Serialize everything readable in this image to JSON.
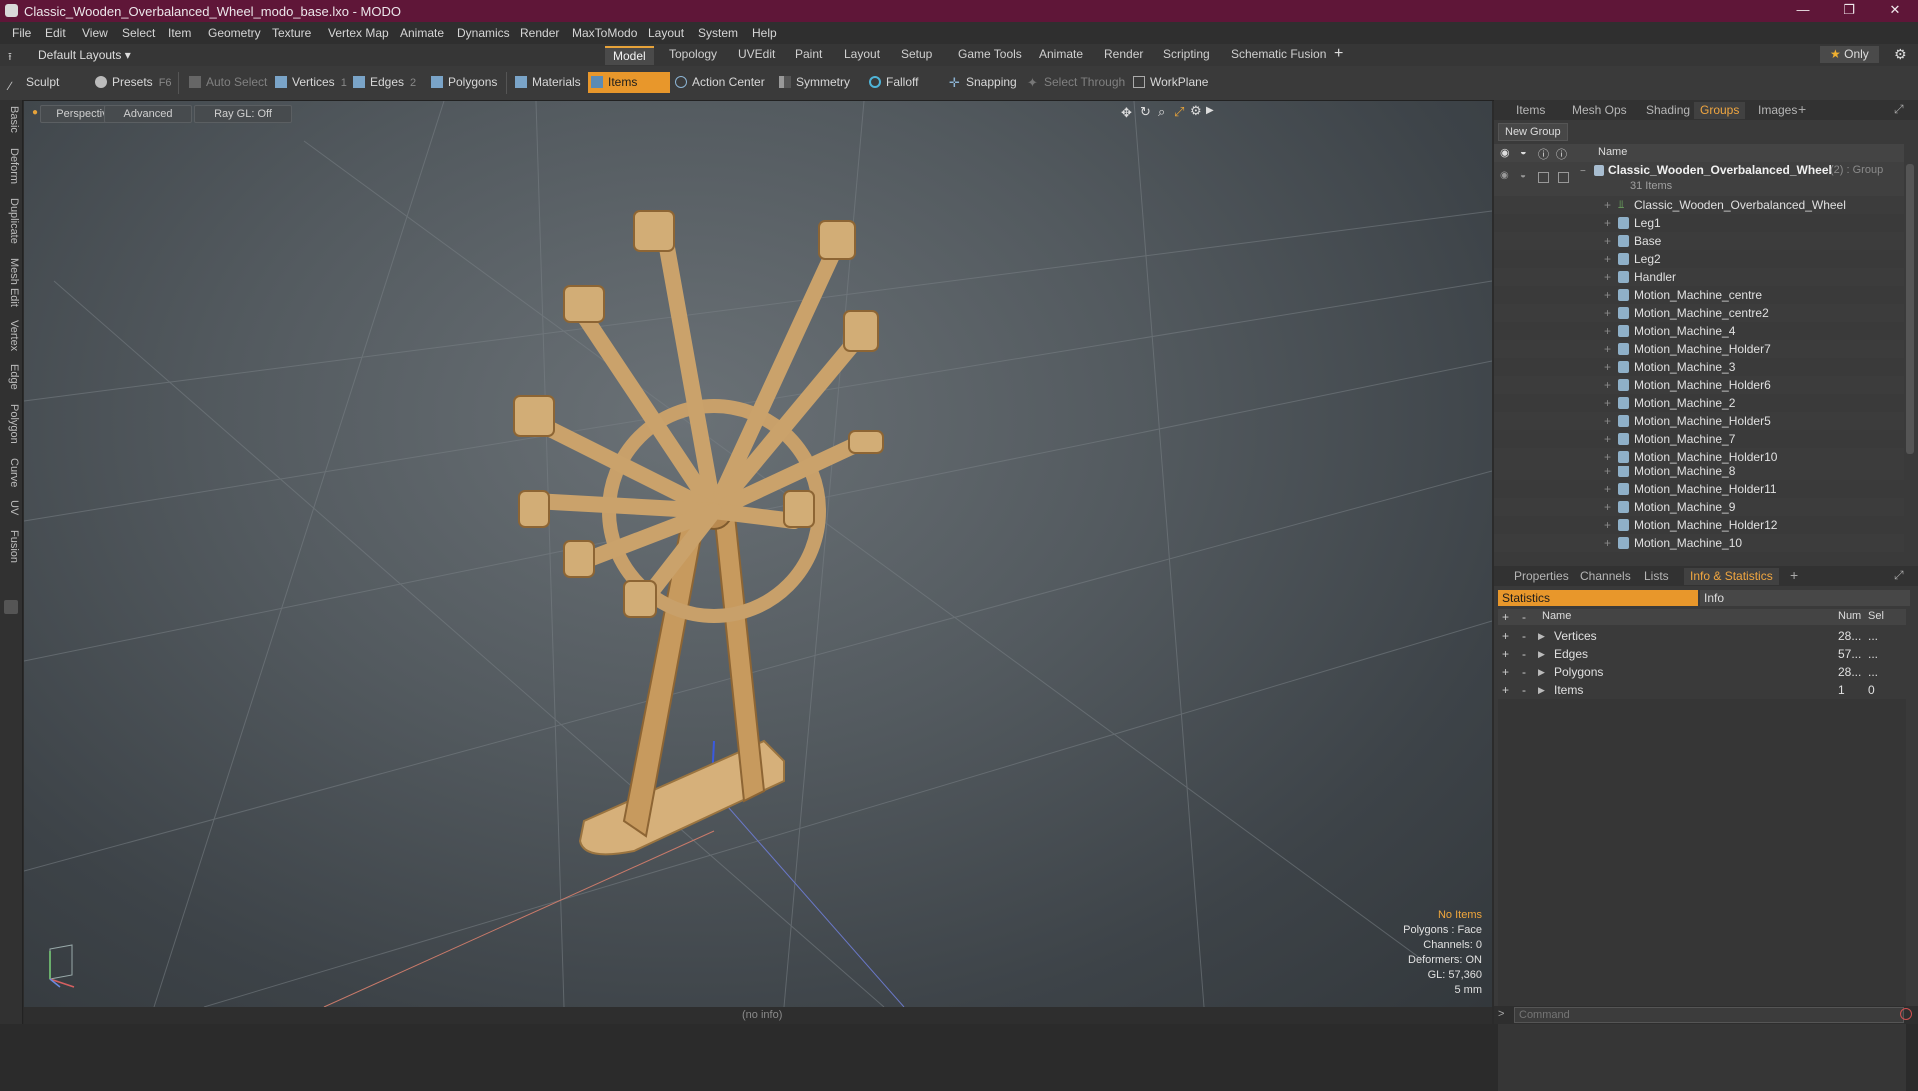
{
  "window": {
    "title": "Classic_Wooden_Overbalanced_Wheel_modo_base.lxo - MODO"
  },
  "menu": [
    "File",
    "Edit",
    "View",
    "Select",
    "Item",
    "Geometry",
    "Texture",
    "Vertex Map",
    "Animate",
    "Dynamics",
    "Render",
    "MaxToModo",
    "Layout",
    "System",
    "Help"
  ],
  "layouts": {
    "selector": "Default Layouts",
    "tabs": [
      "Model",
      "Topology",
      "UVEdit",
      "Paint",
      "Layout",
      "Setup",
      "Game Tools",
      "Animate",
      "Render",
      "Scripting",
      "Schematic Fusion"
    ],
    "active": "Model",
    "only_label": "Only"
  },
  "toolbar": {
    "sculpt": "Sculpt",
    "presets": "Presets",
    "presets_key": "F6",
    "auto_select": "Auto Select",
    "vertices": "Vertices",
    "vertices_num": "1",
    "edges": "Edges",
    "edges_num": "2",
    "polygons": "Polygons",
    "materials": "Materials",
    "items": "Items",
    "action_center": "Action Center",
    "symmetry": "Symmetry",
    "falloff": "Falloff",
    "snapping": "Snapping",
    "select_through": "Select Through",
    "workplane": "WorkPlane"
  },
  "left_tabs": [
    "Basic",
    "Deform",
    "Duplicate",
    "Mesh Edit",
    "Vertex",
    "Edge",
    "Polygon",
    "Curve",
    "UV",
    "Fusion"
  ],
  "viewport": {
    "view_mode": "Perspective",
    "shading": "Advanced",
    "raygl": "Ray GL: Off",
    "stats": {
      "selection": "No Items",
      "polygons": "Polygons : Face",
      "channels": "Channels: 0",
      "deformers": "Deformers: ON",
      "gl": "GL: 57,360",
      "scale": "5 mm"
    },
    "status": "(no info)",
    "colors": {
      "stats_highlight": "#f0a63c",
      "wood": "#c9a06a"
    }
  },
  "outliner": {
    "tabs": [
      "Items",
      "Mesh Ops",
      "Shading",
      "Groups",
      "Images"
    ],
    "active_tab": "Groups",
    "new_group": "New Group",
    "col_name": "Name",
    "group_name": "Classic_Wooden_Overbalanced_Wheel",
    "group_suffix": "(2) : Group",
    "group_count": "31 Items",
    "items": [
      "Classic_Wooden_Overbalanced_Wheel",
      "Leg1",
      "Base",
      "Leg2",
      "Handler",
      "Motion_Machine_centre",
      "Motion_Machine_centre2",
      "Motion_Machine_4",
      "Motion_Machine_Holder7",
      "Motion_Machine_3",
      "Motion_Machine_Holder6",
      "Motion_Machine_2",
      "Motion_Machine_Holder5",
      "Motion_Machine_7",
      "Motion_Machine_Holder10",
      "Motion_Machine_8",
      "Motion_Machine_Holder11",
      "Motion_Machine_9",
      "Motion_Machine_Holder12",
      "Motion_Machine_10"
    ]
  },
  "info_panel": {
    "tabs": [
      "Properties",
      "Channels",
      "Lists",
      "Info & Statistics"
    ],
    "active_tab": "Info & Statistics",
    "statistics_label": "Statistics",
    "info_label": "Info",
    "columns": {
      "name": "Name",
      "num": "Num",
      "sel": "Sel"
    },
    "rows": [
      {
        "name": "Vertices",
        "num": "28...",
        "sel": "..."
      },
      {
        "name": "Edges",
        "num": "57...",
        "sel": "..."
      },
      {
        "name": "Polygons",
        "num": "28...",
        "sel": "..."
      },
      {
        "name": "Items",
        "num": "1",
        "sel": "0"
      }
    ]
  },
  "command": {
    "placeholder": "Command"
  }
}
